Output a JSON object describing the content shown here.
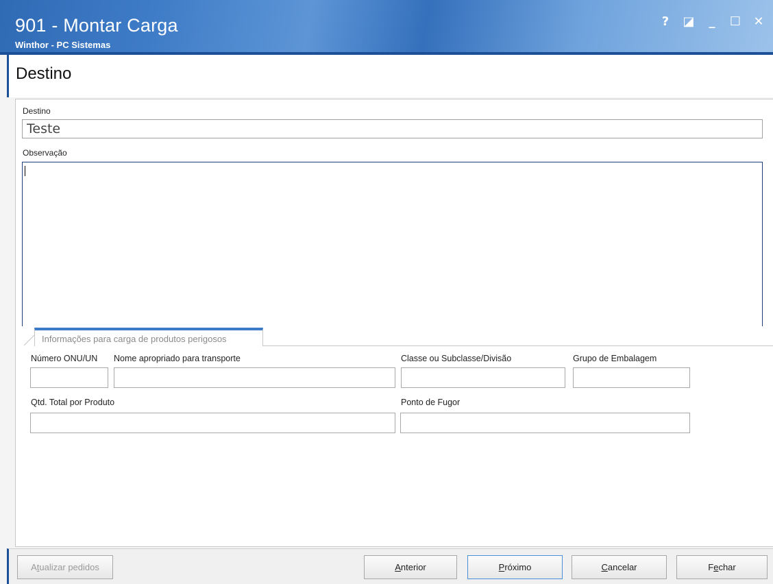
{
  "window": {
    "title": "901 - Montar Carga",
    "subtitle": "Winthor - PC Sistemas",
    "controls": {
      "help": "?",
      "restore": "◪",
      "minimize": "_",
      "maximize": "☐",
      "close": "✕"
    }
  },
  "header": {
    "title": "Destino"
  },
  "form": {
    "destino": {
      "label": "Destino",
      "value": "Teste"
    },
    "observacao": {
      "label": "Observação",
      "value": ""
    }
  },
  "tab": {
    "label": "Informações para carga de produtos perigosos"
  },
  "hazmat": {
    "numero_onu": {
      "label": "Número ONU/UN",
      "value": ""
    },
    "nome_transporte": {
      "label": "Nome apropriado para transporte",
      "value": ""
    },
    "classe": {
      "label": "Classe ou Subclasse/Divisão",
      "value": ""
    },
    "grupo": {
      "label": "Grupo de Embalagem",
      "value": ""
    },
    "qtd_total": {
      "label": "Qtd. Total por Produto",
      "value": ""
    },
    "ponto_fugor": {
      "label": "Ponto de Fugor",
      "value": ""
    }
  },
  "footer": {
    "atualizar": {
      "pre": "A",
      "key": "t",
      "post": "ualizar pedidos"
    },
    "anterior": {
      "pre": "",
      "key": "A",
      "post": "nterior"
    },
    "proximo": {
      "pre": "",
      "key": "P",
      "post": "róximo"
    },
    "cancelar": {
      "pre": "",
      "key": "C",
      "post": "ancelar"
    },
    "fechar": {
      "pre": "F",
      "key": "e",
      "post": "char"
    }
  },
  "colors": {
    "titlebar": "#3f7cc7",
    "accent": "#1d4f96",
    "tab_accent": "#3c7bc8"
  }
}
